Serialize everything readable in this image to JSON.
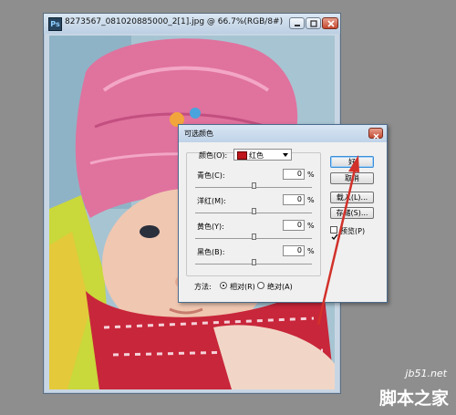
{
  "image_window": {
    "title": "8273567_081020885000_2[1].jpg @ 66.7%(RGB/8#)",
    "icon": "photoshop-document-icon"
  },
  "dialog": {
    "title": "可选颜色",
    "colors_label": "颜色(O):",
    "colors_value": "红色",
    "colors_swatch": "#c0161d",
    "rows": [
      {
        "label": "青色(C):",
        "value": "0",
        "unit": "%"
      },
      {
        "label": "洋红(M):",
        "value": "0",
        "unit": "%"
      },
      {
        "label": "黄色(Y):",
        "value": "0",
        "unit": "%"
      },
      {
        "label": "黑色(B):",
        "value": "0",
        "unit": "%"
      }
    ],
    "buttons": {
      "ok": "好",
      "cancel": "取消",
      "load": "载入(L)...",
      "save": "存储(S)..."
    },
    "preview_label": "预览(P)",
    "preview_checked": true,
    "method_label": "方法:",
    "method_relative": "相对(R)",
    "method_absolute": "绝对(A)",
    "method_selected": "relative"
  },
  "watermark": {
    "url": "jb51.net",
    "name": "脚本之家"
  },
  "colors": {
    "annotation_arrow": "#d2312a",
    "background": "#8e8e8e"
  }
}
